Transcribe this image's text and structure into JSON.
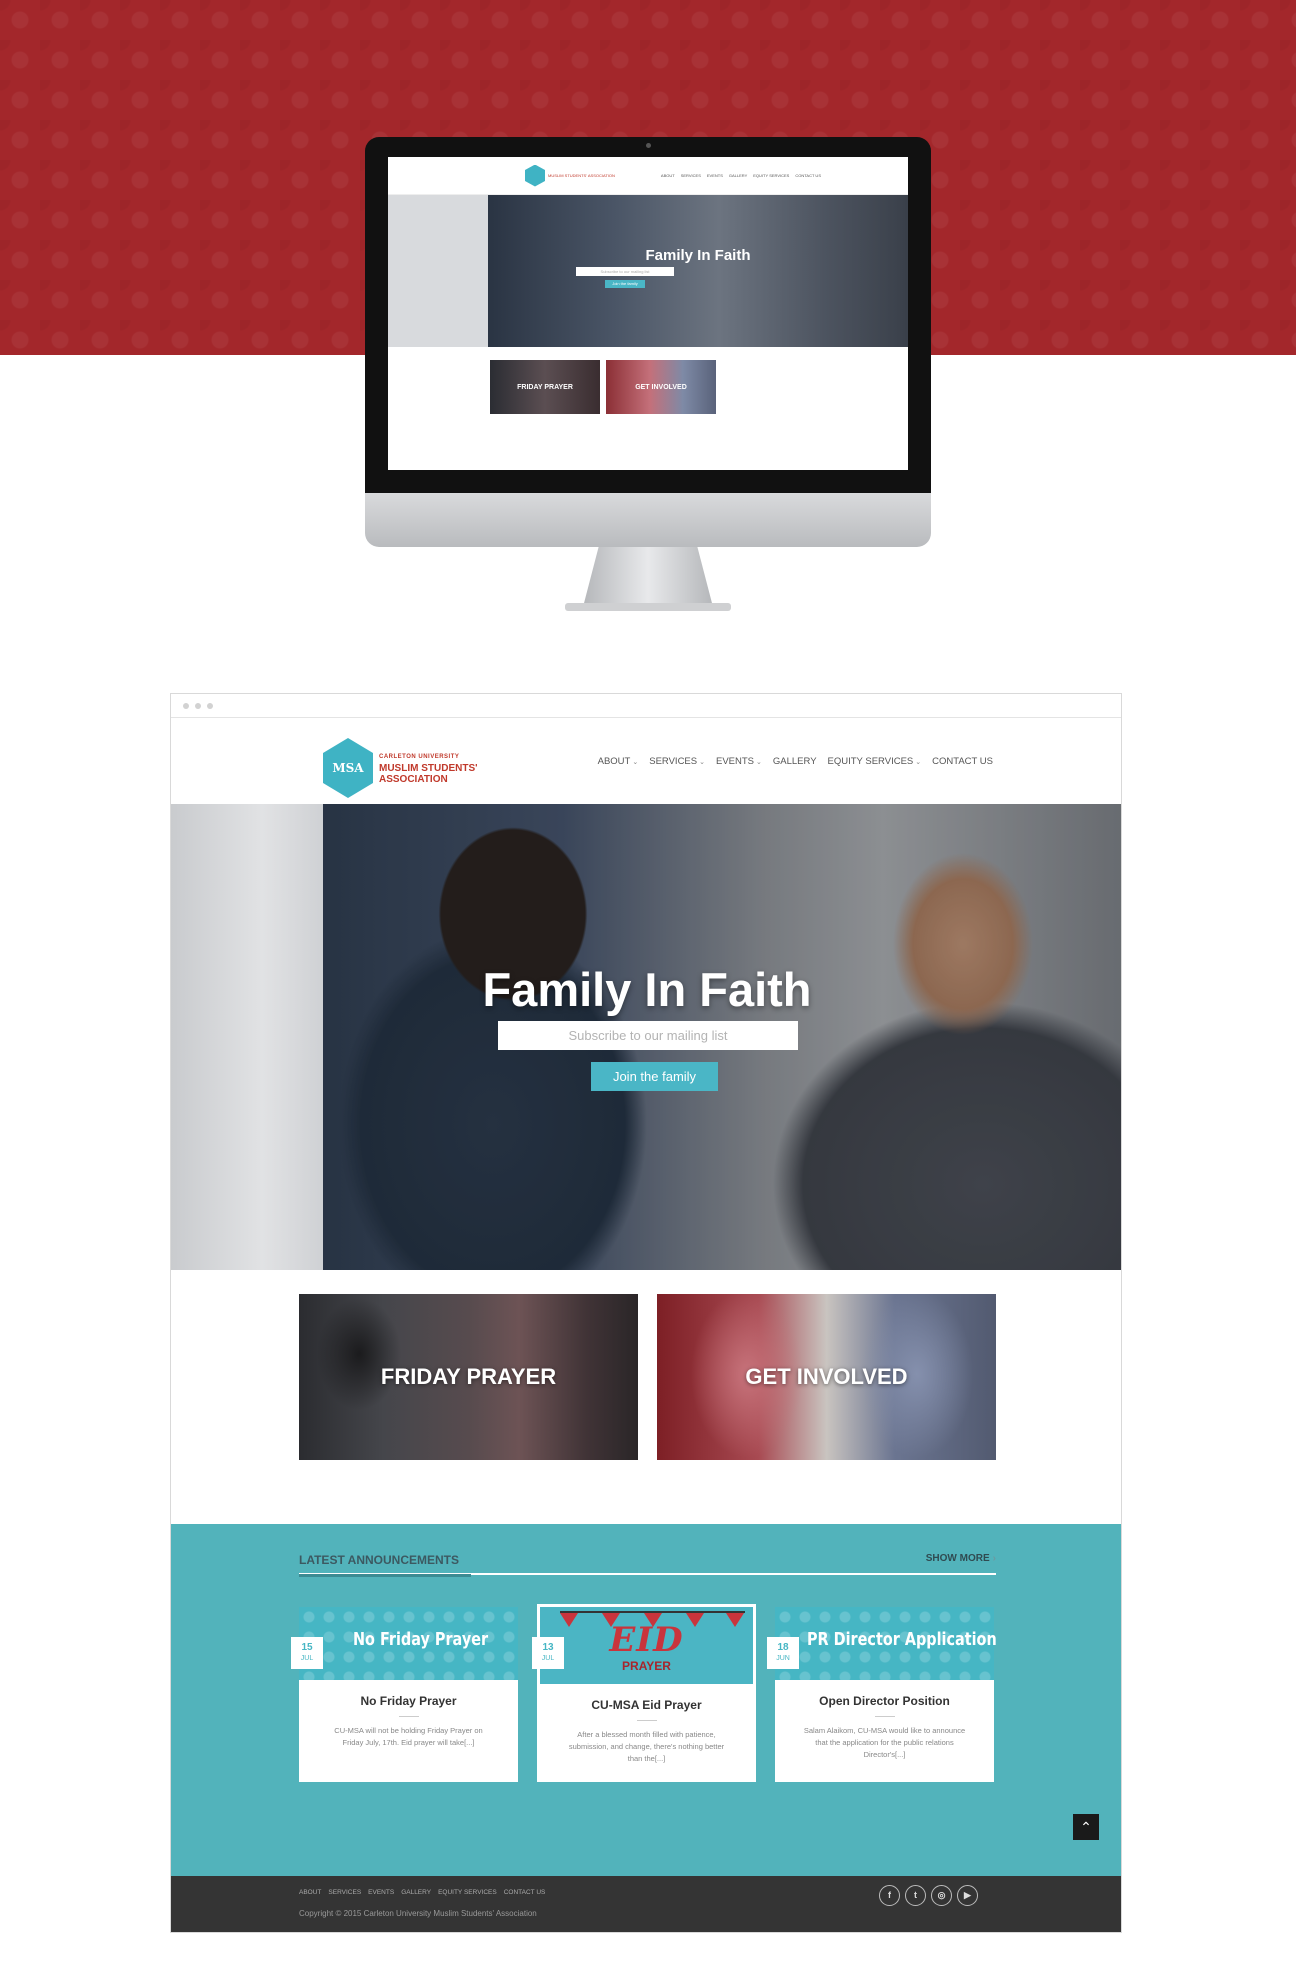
{
  "mini": {
    "logo_text": "MUSLIM STUDENTS' ASSOCIATION",
    "nav": [
      "ABOUT",
      "SERVICES",
      "EVENTS",
      "GALLERY",
      "EQUITY SERVICES",
      "CONTACT US"
    ],
    "hero_title": "Family In Faith",
    "input_placeholder": "Subscribe to our mailing list",
    "button": "Join the family",
    "tiles": [
      "FRIDAY PRAYER",
      "GET INVOLVED"
    ]
  },
  "header": {
    "logo_mark": "MSA",
    "logo_line1": "CARLETON UNIVERSITY",
    "logo_line2": "MUSLIM STUDENTS'",
    "logo_line3": "ASSOCIATION",
    "nav": [
      {
        "label": "ABOUT",
        "dropdown": true
      },
      {
        "label": "SERVICES",
        "dropdown": true
      },
      {
        "label": "EVENTS",
        "dropdown": true
      },
      {
        "label": "GALLERY",
        "dropdown": false
      },
      {
        "label": "EQUITY SERVICES",
        "dropdown": true
      },
      {
        "label": "CONTACT US",
        "dropdown": false
      }
    ]
  },
  "hero": {
    "title": "Family In Faith",
    "input_placeholder": "Subscribe to our mailing list",
    "button": "Join the family"
  },
  "tiles": {
    "friday": "FRIDAY PRAYER",
    "involved": "GET INVOLVED"
  },
  "announcements": {
    "title": "LATEST ANNOUNCEMENTS",
    "show_more": "SHOW MORE",
    "cards": [
      {
        "day": "15",
        "month": "JUL",
        "banner": "No Friday Prayer",
        "title": "No Friday Prayer",
        "text": "CU-MSA will not be holding Friday Prayer on Friday July, 17th. Eid prayer will take[...]"
      },
      {
        "day": "13",
        "month": "JUL",
        "banner": "EID",
        "banner_sub": "PRAYER",
        "title": "CU-MSA Eid Prayer",
        "text": "After a blessed month filled with patience, submission, and change, there's nothing better than the[...]"
      },
      {
        "day": "18",
        "month": "JUN",
        "banner": "PR Director Application",
        "title": "Open Director Position",
        "text": "Salam Alaikom, CU-MSA would like to announce that the application for the public relations Director's[...]"
      }
    ]
  },
  "footer": {
    "nav": [
      "ABOUT",
      "SERVICES",
      "EVENTS",
      "GALLERY",
      "EQUITY SERVICES",
      "CONTACT US"
    ],
    "copyright": "Copyright © 2015 Carleton University Muslim Students' Association",
    "social": [
      "f",
      "t",
      "◎",
      "▶"
    ]
  },
  "colors": {
    "brand_red": "#a3272b",
    "accent_teal": "#4ab6c6",
    "footer_dark": "#343434"
  }
}
